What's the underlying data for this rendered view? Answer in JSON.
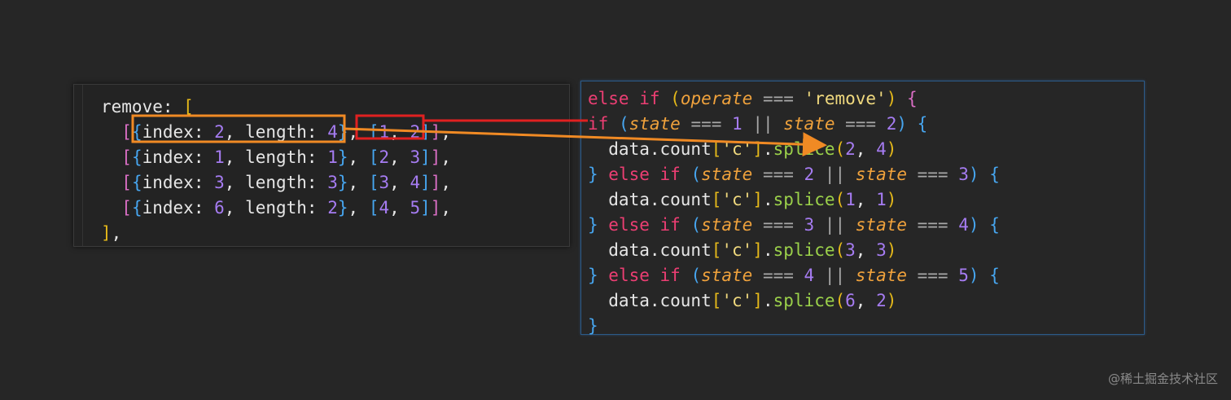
{
  "left_code": {
    "lines": [
      [
        [
          "t-plain",
          "remove: "
        ],
        [
          "t-br1",
          "["
        ]
      ],
      [
        [
          "t-punct",
          "  "
        ],
        [
          "t-br2",
          "["
        ],
        [
          "t-br3",
          "{"
        ],
        [
          "t-plain",
          "index: "
        ],
        [
          "t-num",
          "2"
        ],
        [
          "t-plain",
          ", length: "
        ],
        [
          "t-num",
          "4"
        ],
        [
          "t-br3",
          "}"
        ],
        [
          "t-plain",
          ", "
        ],
        [
          "t-br3",
          "["
        ],
        [
          "t-num",
          "1"
        ],
        [
          "t-plain",
          ", "
        ],
        [
          "t-num",
          "2"
        ],
        [
          "t-br3",
          "]"
        ],
        [
          "t-br2",
          "]"
        ],
        [
          "t-plain",
          ","
        ]
      ],
      [
        [
          "t-punct",
          "  "
        ],
        [
          "t-br2",
          "["
        ],
        [
          "t-br3",
          "{"
        ],
        [
          "t-plain",
          "index: "
        ],
        [
          "t-num",
          "1"
        ],
        [
          "t-plain",
          ", length: "
        ],
        [
          "t-num",
          "1"
        ],
        [
          "t-br3",
          "}"
        ],
        [
          "t-plain",
          ", "
        ],
        [
          "t-br3",
          "["
        ],
        [
          "t-num",
          "2"
        ],
        [
          "t-plain",
          ", "
        ],
        [
          "t-num",
          "3"
        ],
        [
          "t-br3",
          "]"
        ],
        [
          "t-br2",
          "]"
        ],
        [
          "t-plain",
          ","
        ]
      ],
      [
        [
          "t-punct",
          "  "
        ],
        [
          "t-br2",
          "["
        ],
        [
          "t-br3",
          "{"
        ],
        [
          "t-plain",
          "index: "
        ],
        [
          "t-num",
          "3"
        ],
        [
          "t-plain",
          ", length: "
        ],
        [
          "t-num",
          "3"
        ],
        [
          "t-br3",
          "}"
        ],
        [
          "t-plain",
          ", "
        ],
        [
          "t-br3",
          "["
        ],
        [
          "t-num",
          "3"
        ],
        [
          "t-plain",
          ", "
        ],
        [
          "t-num",
          "4"
        ],
        [
          "t-br3",
          "]"
        ],
        [
          "t-br2",
          "]"
        ],
        [
          "t-plain",
          ","
        ]
      ],
      [
        [
          "t-punct",
          "  "
        ],
        [
          "t-br2",
          "["
        ],
        [
          "t-br3",
          "{"
        ],
        [
          "t-plain",
          "index: "
        ],
        [
          "t-num",
          "6"
        ],
        [
          "t-plain",
          ", length: "
        ],
        [
          "t-num",
          "2"
        ],
        [
          "t-br3",
          "}"
        ],
        [
          "t-plain",
          ", "
        ],
        [
          "t-br3",
          "["
        ],
        [
          "t-num",
          "4"
        ],
        [
          "t-plain",
          ", "
        ],
        [
          "t-num",
          "5"
        ],
        [
          "t-br3",
          "]"
        ],
        [
          "t-br2",
          "]"
        ],
        [
          "t-plain",
          ","
        ]
      ],
      [
        [
          "t-br1",
          "]"
        ],
        [
          "t-plain",
          ","
        ]
      ]
    ]
  },
  "right_code": {
    "lines": [
      [
        [
          "t-kw",
          "else if "
        ],
        [
          "t-br1",
          "("
        ],
        [
          "t-param",
          "operate"
        ],
        [
          "t-op",
          " === "
        ],
        [
          "t-str",
          "'remove'"
        ],
        [
          "t-br1",
          ")"
        ],
        [
          "t-plain",
          " "
        ],
        [
          "t-br2",
          "{"
        ]
      ],
      [
        [
          "t-kw",
          "if "
        ],
        [
          "t-br3",
          "("
        ],
        [
          "t-param",
          "state"
        ],
        [
          "t-op",
          " === "
        ],
        [
          "t-num",
          "1"
        ],
        [
          "t-op",
          " || "
        ],
        [
          "t-param",
          "state"
        ],
        [
          "t-op",
          " === "
        ],
        [
          "t-num",
          "2"
        ],
        [
          "t-br3",
          ")"
        ],
        [
          "t-plain",
          " "
        ],
        [
          "t-br3",
          "{"
        ]
      ],
      [
        [
          "t-plain",
          "  data.count"
        ],
        [
          "t-br1",
          "["
        ],
        [
          "t-str",
          "'c'"
        ],
        [
          "t-br1",
          "]"
        ],
        [
          "t-plain",
          "."
        ],
        [
          "t-fn",
          "splice"
        ],
        [
          "t-br1",
          "("
        ],
        [
          "t-num",
          "2"
        ],
        [
          "t-plain",
          ", "
        ],
        [
          "t-num",
          "4"
        ],
        [
          "t-br1",
          ")"
        ]
      ],
      [
        [
          "t-br3",
          "}"
        ],
        [
          "t-kw",
          " else if "
        ],
        [
          "t-br3",
          "("
        ],
        [
          "t-param",
          "state"
        ],
        [
          "t-op",
          " === "
        ],
        [
          "t-num",
          "2"
        ],
        [
          "t-op",
          " || "
        ],
        [
          "t-param",
          "state"
        ],
        [
          "t-op",
          " === "
        ],
        [
          "t-num",
          "3"
        ],
        [
          "t-br3",
          ")"
        ],
        [
          "t-plain",
          " "
        ],
        [
          "t-br3",
          "{"
        ]
      ],
      [
        [
          "t-plain",
          "  data.count"
        ],
        [
          "t-br1",
          "["
        ],
        [
          "t-str",
          "'c'"
        ],
        [
          "t-br1",
          "]"
        ],
        [
          "t-plain",
          "."
        ],
        [
          "t-fn",
          "splice"
        ],
        [
          "t-br1",
          "("
        ],
        [
          "t-num",
          "1"
        ],
        [
          "t-plain",
          ", "
        ],
        [
          "t-num",
          "1"
        ],
        [
          "t-br1",
          ")"
        ]
      ],
      [
        [
          "t-br3",
          "}"
        ],
        [
          "t-kw",
          " else if "
        ],
        [
          "t-br3",
          "("
        ],
        [
          "t-param",
          "state"
        ],
        [
          "t-op",
          " === "
        ],
        [
          "t-num",
          "3"
        ],
        [
          "t-op",
          " || "
        ],
        [
          "t-param",
          "state"
        ],
        [
          "t-op",
          " === "
        ],
        [
          "t-num",
          "4"
        ],
        [
          "t-br3",
          ")"
        ],
        [
          "t-plain",
          " "
        ],
        [
          "t-br3",
          "{"
        ]
      ],
      [
        [
          "t-plain",
          "  data.count"
        ],
        [
          "t-br1",
          "["
        ],
        [
          "t-str",
          "'c'"
        ],
        [
          "t-br1",
          "]"
        ],
        [
          "t-plain",
          "."
        ],
        [
          "t-fn",
          "splice"
        ],
        [
          "t-br1",
          "("
        ],
        [
          "t-num",
          "3"
        ],
        [
          "t-plain",
          ", "
        ],
        [
          "t-num",
          "3"
        ],
        [
          "t-br1",
          ")"
        ]
      ],
      [
        [
          "t-br3",
          "}"
        ],
        [
          "t-kw",
          " else if "
        ],
        [
          "t-br3",
          "("
        ],
        [
          "t-param",
          "state"
        ],
        [
          "t-op",
          " === "
        ],
        [
          "t-num",
          "4"
        ],
        [
          "t-op",
          " || "
        ],
        [
          "t-param",
          "state"
        ],
        [
          "t-op",
          " === "
        ],
        [
          "t-num",
          "5"
        ],
        [
          "t-br3",
          ")"
        ],
        [
          "t-plain",
          " "
        ],
        [
          "t-br3",
          "{"
        ]
      ],
      [
        [
          "t-plain",
          "  data.count"
        ],
        [
          "t-br1",
          "["
        ],
        [
          "t-str",
          "'c'"
        ],
        [
          "t-br1",
          "]"
        ],
        [
          "t-plain",
          "."
        ],
        [
          "t-fn",
          "splice"
        ],
        [
          "t-br1",
          "("
        ],
        [
          "t-num",
          "6"
        ],
        [
          "t-plain",
          ", "
        ],
        [
          "t-num",
          "2"
        ],
        [
          "t-br1",
          ")"
        ]
      ],
      [
        [
          "t-br3",
          "}"
        ]
      ]
    ]
  },
  "annotations": {
    "orange_color": "#f08a24",
    "red_color": "#e02020"
  },
  "watermark": "@稀土掘金技术社区"
}
